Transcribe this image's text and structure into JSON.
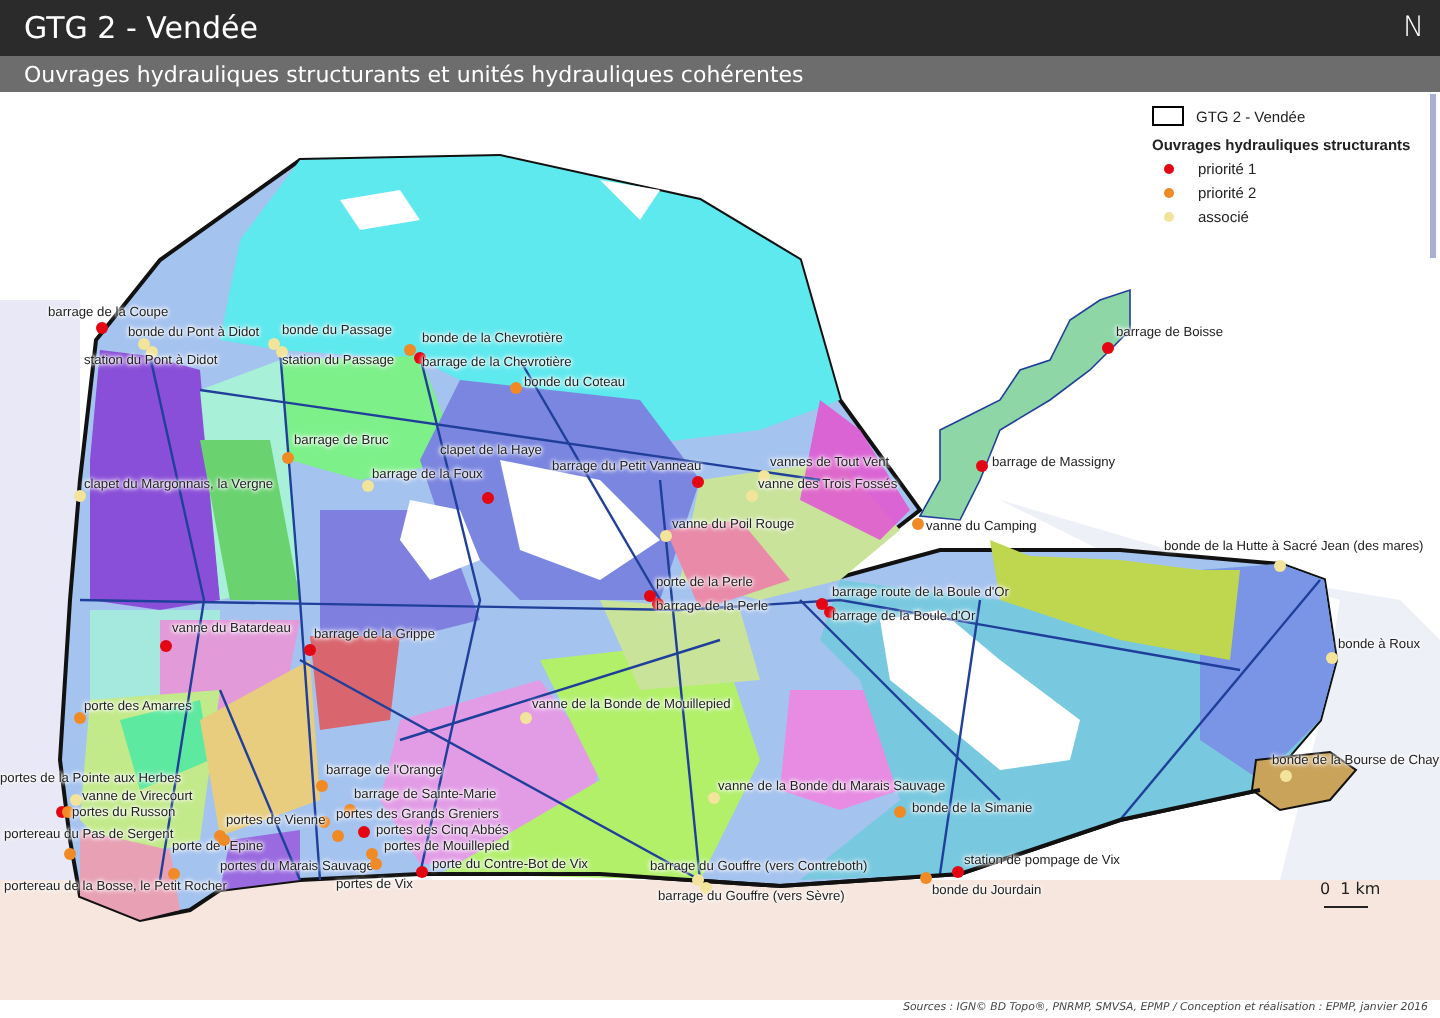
{
  "header": {
    "title": "GTG 2 - Vendée",
    "north": "N"
  },
  "subtitle": "Ouvrages hydrauliques structurants et unités hydrauliques cohérentes",
  "legend": {
    "boundary": "GTG 2 - Vendée",
    "heading": "Ouvrages hydrauliques structurants",
    "items": [
      {
        "label": "priorité 1",
        "color": "#e30613"
      },
      {
        "label": "priorité 2",
        "color": "#f08a24"
      },
      {
        "label": "associé",
        "color": "#f3e49b"
      }
    ]
  },
  "map": {
    "points": [
      {
        "label": "barrage de la Coupe",
        "color": "#e30613"
      },
      {
        "label": "bonde du Pont à Didot",
        "color": "#f3e49b"
      },
      {
        "label": "station du Pont à Didot",
        "color": "#f3e49b"
      },
      {
        "label": "bonde du Passage",
        "color": "#f3e49b"
      },
      {
        "label": "station du Passage",
        "color": "#f3e49b"
      },
      {
        "label": "bonde de la Chevrotière",
        "color": "#f08a24"
      },
      {
        "label": "barrage de la Chevrotière",
        "color": "#e30613"
      },
      {
        "label": "bonde du Coteau",
        "color": "#f08a24"
      },
      {
        "label": "barrage de Bruc",
        "color": "#f08a24"
      },
      {
        "label": "barrage de la Foux",
        "color": "#f3e49b"
      },
      {
        "label": "clapet de la Haye",
        "color": "#e30613"
      },
      {
        "label": "clapet du Margonnais, la Vergne",
        "color": "#f3e49b"
      },
      {
        "label": "barrage du Petit Vanneau",
        "color": "#e30613"
      },
      {
        "label": "vannes de Tout Vent",
        "color": "#f3e49b"
      },
      {
        "label": "vanne des Trois Fossés",
        "color": "#f3e49b"
      },
      {
        "label": "vanne du Poil Rouge",
        "color": "#f3e49b"
      },
      {
        "label": "barrage de Massigny",
        "color": "#e30613"
      },
      {
        "label": "barrage de Boisse",
        "color": "#e30613"
      },
      {
        "label": "vanne du Camping",
        "color": "#f08a24"
      },
      {
        "label": "porte de la Perle",
        "color": "#e30613"
      },
      {
        "label": "barrage de la Perle",
        "color": "#e30613"
      },
      {
        "label": "barrage route de la Boule d'Or",
        "color": "#e30613"
      },
      {
        "label": "barrage de la Boule d'Or",
        "color": "#e30613"
      },
      {
        "label": "bonde de la Hutte à  Sacré Jean (des mares)",
        "color": "#f3e49b"
      },
      {
        "label": "bonde à Roux",
        "color": "#f3e49b"
      },
      {
        "label": "bonde de la Bourse de Chay",
        "color": "#f3e49b"
      },
      {
        "label": "vanne du Batardeau",
        "color": "#e30613"
      },
      {
        "label": "barrage de la Grippe",
        "color": "#e30613"
      },
      {
        "label": "porte des Amarres",
        "color": "#f08a24"
      },
      {
        "label": "vanne de la Bonde de Mouillepied",
        "color": "#f3e49b"
      },
      {
        "label": "portes de la Pointe aux Herbes",
        "color": "#e30613"
      },
      {
        "label": "vanne de Virecourt",
        "color": "#f3e49b"
      },
      {
        "label": "portes du Russon",
        "color": "#f08a24"
      },
      {
        "label": "portereau du Pas de Sergent",
        "color": "#f08a24"
      },
      {
        "label": "porte de l'Epine",
        "color": "#f08a24"
      },
      {
        "label": "portereau de la Bosse, le Petit Rocher",
        "color": "#f08a24"
      },
      {
        "label": "portes de Vienne",
        "color": "#f08a24"
      },
      {
        "label": "portes du Marais Sauvage",
        "color": "#f08a24"
      },
      {
        "label": "barrage de l'Orange",
        "color": "#f08a24"
      },
      {
        "label": "barrage de Sainte-Marie",
        "color": "#f08a24"
      },
      {
        "label": "portes des Grands Greniers",
        "color": "#f08a24"
      },
      {
        "label": "portes des Cinq Abbés",
        "color": "#e30613"
      },
      {
        "label": "portes de Mouillepied",
        "color": "#f08a24"
      },
      {
        "label": "portes de Vix",
        "color": "#f08a24"
      },
      {
        "label": "porte du Contre-Bot de Vix",
        "color": "#e30613"
      },
      {
        "label": "barrage du Gouffre (vers Contreboth)",
        "color": "#f3e49b"
      },
      {
        "label": "barrage du Gouffre (vers Sèvre)",
        "color": "#f3e49b"
      },
      {
        "label": "vanne de la Bonde du Marais Sauvage",
        "color": "#f3e49b"
      },
      {
        "label": "bonde de la Simanie",
        "color": "#f08a24"
      },
      {
        "label": "station de pompage de Vix",
        "color": "#e30613"
      },
      {
        "label": "bonde du Jourdain",
        "color": "#f08a24"
      }
    ]
  },
  "scale": {
    "zero": "0",
    "distance": "1 km"
  },
  "sources": "Sources : IGN© BD Topo®, PNRMP, SMVSA, EPMP / Conception et réalisation : EPMP, janvier 2016"
}
